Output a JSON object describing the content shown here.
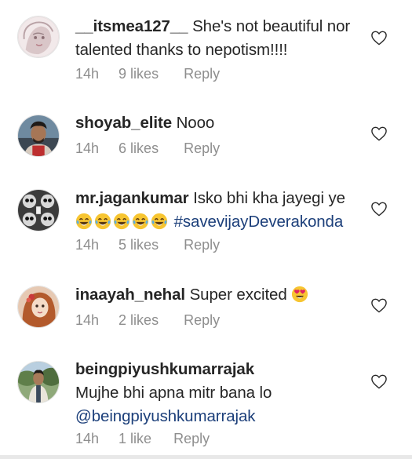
{
  "comments": [
    {
      "username": "__itsmea127__",
      "text": " She's not beautiful nor talented thanks to nepotism!!!!",
      "time": "14h",
      "likes": "9 likes",
      "reply": "Reply",
      "avatar": "avatar-girl-sketch"
    },
    {
      "username": "shoyab_elite",
      "text": " Nooo",
      "time": "14h",
      "likes": "6 likes",
      "reply": "Reply",
      "avatar": "avatar-man-photo"
    },
    {
      "username": "mr.jagankumar",
      "text": " Isko bhi kha jayegi ye",
      "emoji": "laughing-tears-emoji",
      "emoji_count": 5,
      "hashtag": "#savevijayDeverakonda",
      "time": "14h",
      "likes": "5 likes",
      "reply": "Reply",
      "avatar": "avatar-skull-collage"
    },
    {
      "username": "inaayah_nehal",
      "text": " Super excited ",
      "emoji": "heart-eyes-emoji",
      "time": "14h",
      "likes": "2 likes",
      "reply": "Reply",
      "avatar": "avatar-doll-portrait"
    },
    {
      "username": "beingpiyushkumarrajak",
      "text": "Mujhe bhi apna mitr bana lo",
      "mention": "@beingpiyushkumarrajak",
      "time": "14h",
      "likes": "1 like",
      "reply": "Reply",
      "avatar": "avatar-man-outdoor"
    }
  ],
  "icons": {
    "like": "heart-outline-icon"
  },
  "colors": {
    "text": "#262626",
    "meta": "#8e8e8e",
    "link": "#1c3f7a",
    "heart_stroke": "#262626"
  }
}
